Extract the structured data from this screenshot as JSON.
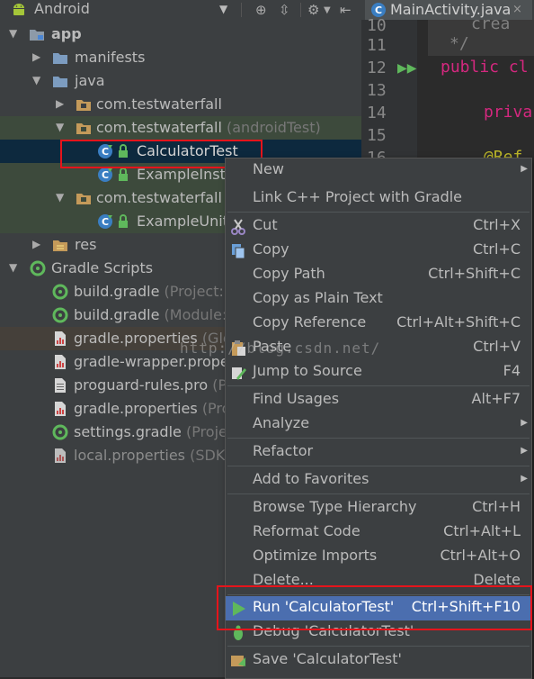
{
  "project_view": {
    "title": "Android",
    "dropdown_glyph": "▼"
  },
  "editor_tab": {
    "label": "MainActivity.java",
    "close": "×"
  },
  "tree": [
    {
      "label": "app",
      "icon": "module-folder-icon",
      "arrow": "▼"
    },
    {
      "label": "manifests",
      "icon": "folder-icon",
      "arrow": "▶"
    },
    {
      "label": "java",
      "icon": "folder-icon",
      "arrow": "▼"
    },
    {
      "label": "com.testwaterfall",
      "icon": "package-icon",
      "arrow": "▶"
    },
    {
      "label": "com.testwaterfall",
      "suffix": "(androidTest)",
      "icon": "package-icon",
      "arrow": "▼"
    },
    {
      "label": "CalculatorTest",
      "icon": "test-class-icon"
    },
    {
      "label": "ExampleInstr",
      "icon": "test-class-icon"
    },
    {
      "label": "com.testwaterfall",
      "suffix": "(",
      "icon": "package-icon",
      "arrow": "▼"
    },
    {
      "label": "ExampleUnitT",
      "icon": "test-class-icon"
    },
    {
      "label": "res",
      "icon": "res-folder-icon",
      "arrow": "▶"
    },
    {
      "label": "Gradle Scripts",
      "icon": "gradle-icon",
      "arrow": "▼"
    },
    {
      "label": "build.gradle",
      "suffix": "(Project: T",
      "icon": "gradle-file-icon"
    },
    {
      "label": "build.gradle",
      "suffix": "(Module:",
      "icon": "gradle-file-icon"
    },
    {
      "label": "gradle.properties",
      "suffix": "(Glob",
      "icon": "properties-file-icon"
    },
    {
      "label": "gradle-wrapper.prope",
      "icon": "properties-file-icon"
    },
    {
      "label": "proguard-rules.pro",
      "suffix": "(Pr",
      "icon": "text-file-icon"
    },
    {
      "label": "gradle.properties",
      "suffix": "(Proj",
      "icon": "properties-file-icon"
    },
    {
      "label": "settings.gradle",
      "suffix": "(Projec",
      "icon": "gradle-file-icon"
    },
    {
      "label": "local.properties",
      "suffix": "(SDK L",
      "icon": "properties-file-icon"
    }
  ],
  "editor": {
    "line_numbers": [
      "10",
      "11",
      "12",
      "13",
      "14",
      "15",
      "16"
    ],
    "code_lines": [
      "crea",
      "*/",
      "public cl",
      "",
      "priva",
      "",
      "@Ref"
    ]
  },
  "menu": {
    "items": [
      {
        "label": "New",
        "shortcut": "",
        "submenu": true
      },
      {
        "label": "Link C++ Project with Gradle",
        "shortcut": ""
      },
      {
        "label": "Cut",
        "shortcut": "Ctrl+X",
        "icon": "scissors-icon"
      },
      {
        "label": "Copy",
        "shortcut": "Ctrl+C",
        "icon": "copy-icon"
      },
      {
        "label": "Copy Path",
        "shortcut": "Ctrl+Shift+C"
      },
      {
        "label": "Copy as Plain Text",
        "shortcut": ""
      },
      {
        "label": "Copy Reference",
        "shortcut": "Ctrl+Alt+Shift+C"
      },
      {
        "label": "Paste",
        "shortcut": "Ctrl+V",
        "icon": "paste-icon"
      },
      {
        "label": "Jump to Source",
        "shortcut": "F4",
        "icon": "edit-source-icon"
      },
      {
        "label": "Find Usages",
        "shortcut": "Alt+F7"
      },
      {
        "label": "Analyze",
        "shortcut": "",
        "submenu": true
      },
      {
        "label": "Refactor",
        "shortcut": "",
        "submenu": true
      },
      {
        "label": "Add to Favorites",
        "shortcut": "",
        "submenu": true
      },
      {
        "label": "Browse Type Hierarchy",
        "shortcut": "Ctrl+H"
      },
      {
        "label": "Reformat Code",
        "shortcut": "Ctrl+Alt+L"
      },
      {
        "label": "Optimize Imports",
        "shortcut": "Ctrl+Alt+O"
      },
      {
        "label": "Delete...",
        "shortcut": "Delete"
      },
      {
        "label": "Run 'CalculatorTest'",
        "shortcut": "Ctrl+Shift+F10",
        "icon": "run-icon",
        "active": true
      },
      {
        "label": "Debug 'CalculatorTest'",
        "shortcut": "",
        "icon": "debug-icon"
      },
      {
        "label": "Save 'CalculatorTest'",
        "shortcut": "",
        "icon": "save-config-icon"
      }
    ],
    "submenu_glyph": "▶"
  },
  "watermark": "http://blog.csdn.net/",
  "colors": {
    "accent_selection": "#4b6eaf",
    "highlight_box": "#e5141b",
    "keyword": "#cc7832"
  }
}
